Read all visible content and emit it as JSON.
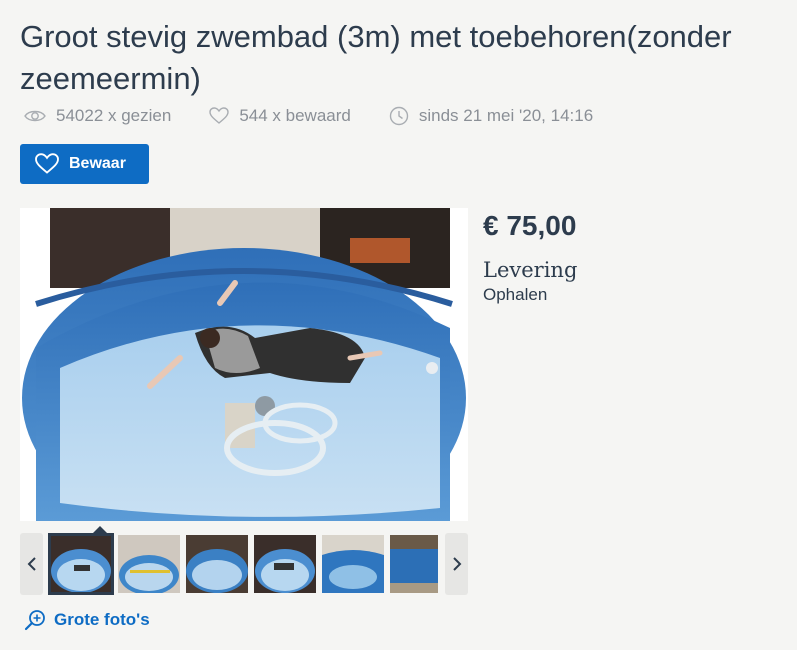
{
  "listing": {
    "title": "Groot stevig zwembad (3m) met toebehoren(zonder zeemeermin)",
    "views": "54022 x gezien",
    "saves": "544 x bewaard",
    "since": "sinds 21 mei '20, 14:16",
    "save_button": "Bewaar",
    "price": "€ 75,00",
    "delivery_label": "Levering",
    "delivery_value": "Ophalen"
  },
  "gallery": {
    "photo_count_visible": 6,
    "active_index": 0,
    "big_photos_link": "Grote foto's"
  },
  "colors": {
    "accent": "#0e6cc4",
    "text": "#2d3c4d",
    "muted": "#8a8f96",
    "background": "#f5f5f3"
  },
  "icons": {
    "views": "eye-icon",
    "saves": "heart-icon",
    "since": "clock-icon",
    "save_button": "heart-icon",
    "prev": "chevron-left-icon",
    "next": "chevron-right-icon",
    "big_photos": "zoom-in-icon"
  }
}
